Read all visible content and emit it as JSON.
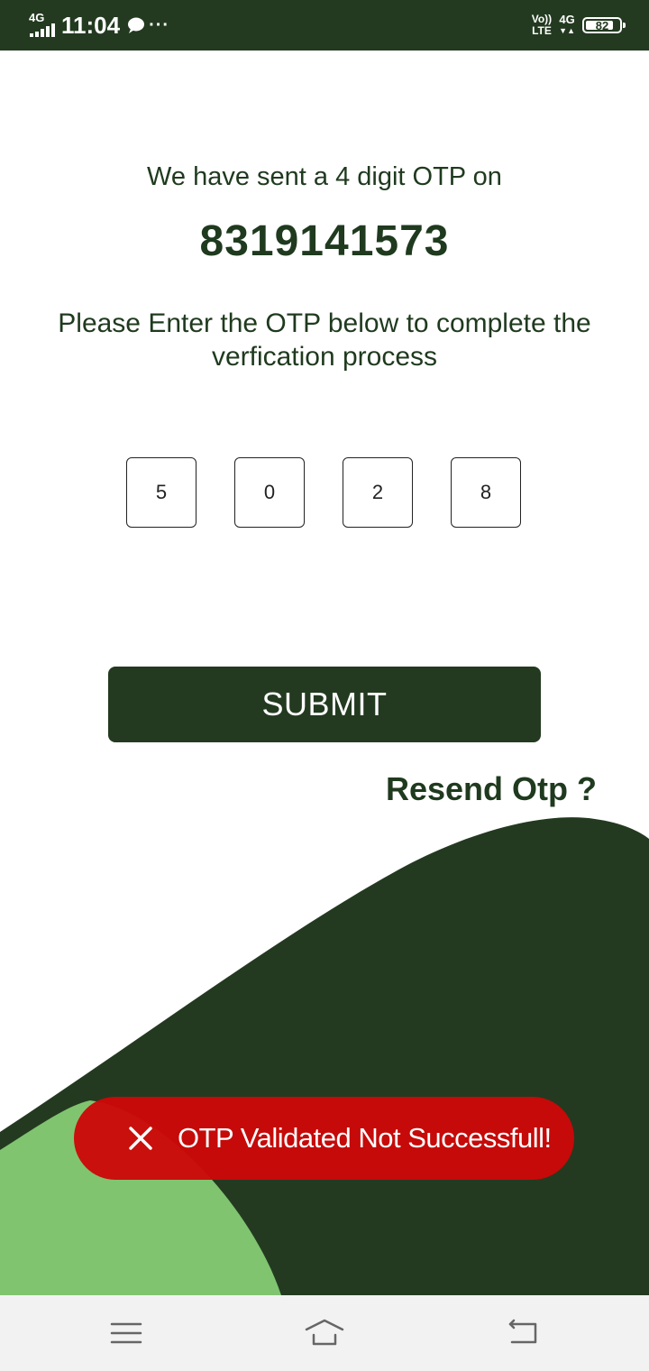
{
  "status_bar": {
    "network_left": "4G",
    "time": "11:04",
    "more": "···",
    "volte_top": "Vo))",
    "volte_bottom": "LTE",
    "network_right": "4G",
    "battery_level": "82"
  },
  "otp_screen": {
    "sent_message": "We have sent a 4 digit OTP on",
    "phone_number": "8319141573",
    "instruction": "Please Enter the OTP below to complete the verfication process",
    "otp_digits": [
      "5",
      "0",
      "2",
      "8"
    ],
    "submit_label": "SUBMIT",
    "resend_label": "Resend Otp ?"
  },
  "toast": {
    "message": "OTP Validated Not Successfull!",
    "icon": "close-icon"
  },
  "nav_bar": {
    "icons": [
      "menu-icon",
      "home-icon",
      "back-icon"
    ]
  },
  "colors": {
    "primary_dark_green": "#233a20",
    "light_green": "#80c470",
    "error_red": "#cc0808",
    "text_dark_green": "#1f3a1e"
  }
}
